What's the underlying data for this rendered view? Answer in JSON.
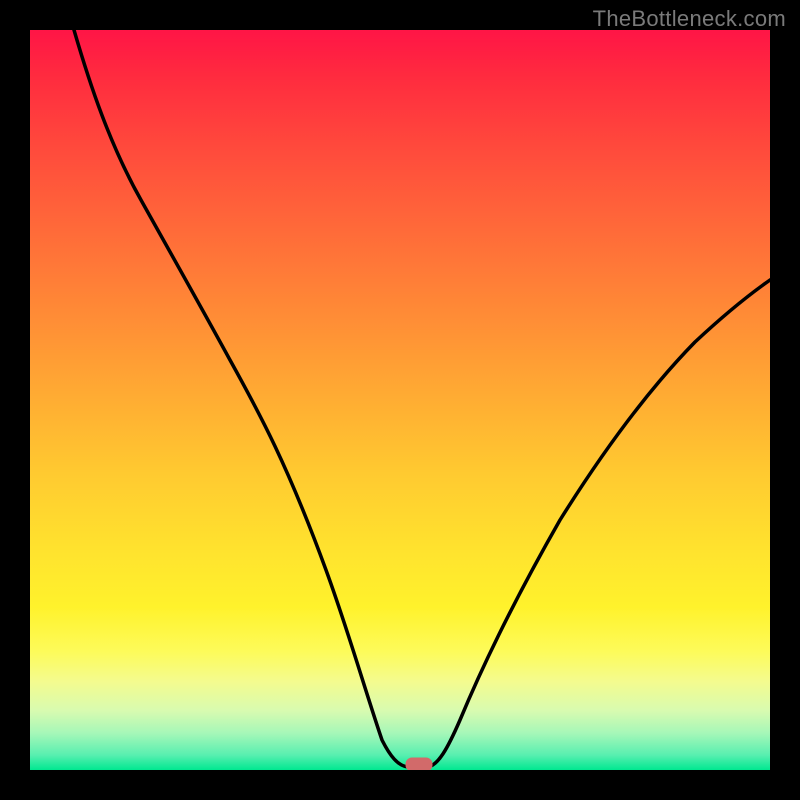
{
  "watermark": "TheBottleneck.com",
  "chart_data": {
    "type": "line",
    "title": "",
    "xlabel": "",
    "ylabel": "",
    "xlim": [
      0,
      100
    ],
    "ylim": [
      0,
      100
    ],
    "grid": false,
    "notes": "V-shaped bottleneck curve on a vertical red→green gradient. Y axis loosely reads as bottleneck % (top≈100%, bottom≈0%). X axis is an unlabeled 0–100 component-balance scale.",
    "series": [
      {
        "name": "bottleneck-curve",
        "x": [
          6,
          10,
          15,
          20,
          25,
          30,
          35,
          40,
          44,
          47,
          50,
          52,
          55,
          60,
          65,
          70,
          75,
          80,
          85,
          90,
          95,
          100
        ],
        "y": [
          100,
          91,
          80,
          70,
          60,
          50,
          41,
          30,
          16,
          6,
          1,
          0,
          1,
          8,
          17,
          26,
          34,
          42,
          49,
          55,
          60,
          64
        ]
      }
    ],
    "marker": {
      "x": 52,
      "y": 0,
      "shape": "rounded-rect",
      "color": "#d26a6a"
    },
    "gradient_stops": [
      {
        "pos": 0,
        "color": "#ff1546"
      },
      {
        "pos": 50,
        "color": "#ffaa33"
      },
      {
        "pos": 80,
        "color": "#fff22c"
      },
      {
        "pos": 100,
        "color": "#00e890"
      }
    ]
  }
}
